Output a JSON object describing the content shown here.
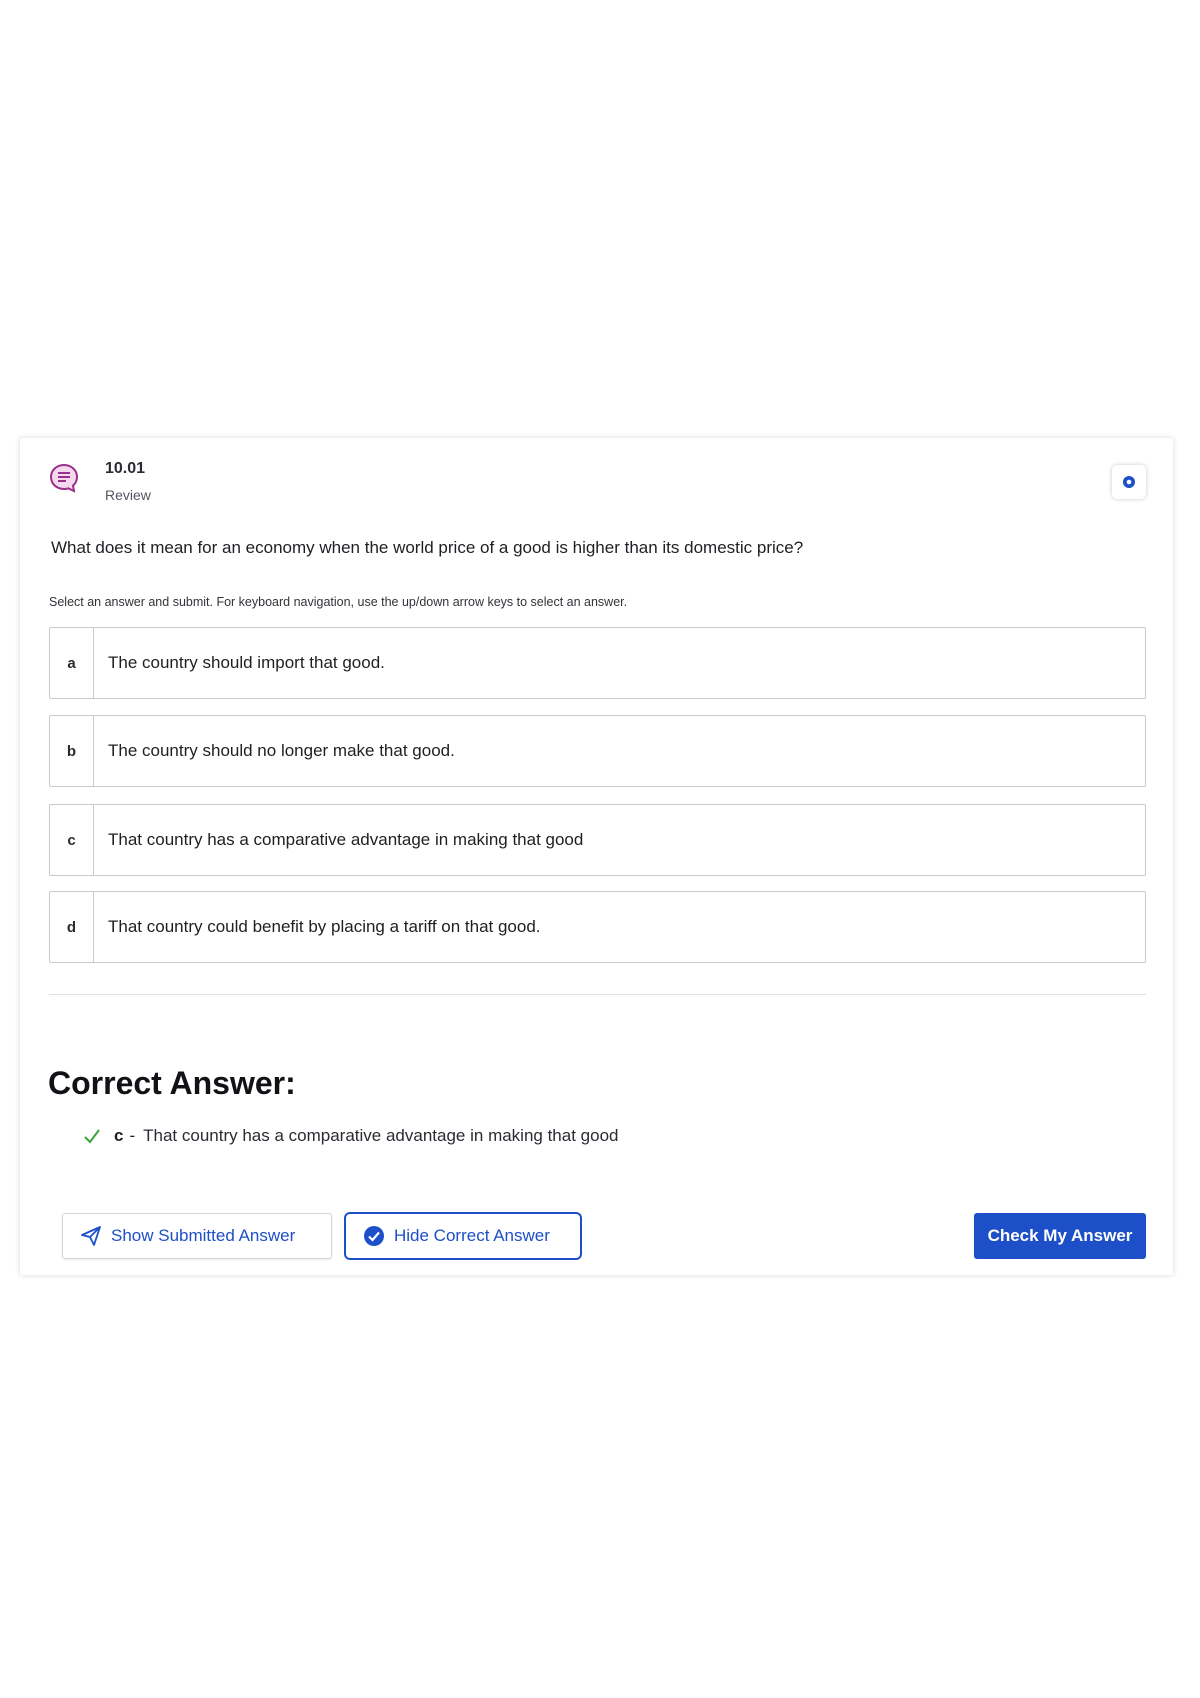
{
  "header": {
    "number": "10.01",
    "subtitle": "Review",
    "icon": "discussion-icon"
  },
  "settings": {
    "icon": "gear-icon"
  },
  "question": {
    "text": "What does it mean for an economy when the world price of a good is higher than its domestic price?",
    "instructions": "Select an answer and submit. For keyboard navigation, use the up/down arrow keys to select an answer."
  },
  "options": [
    {
      "letter": "a",
      "text": "The country should import that good."
    },
    {
      "letter": "b",
      "text": "The country should no longer make that good."
    },
    {
      "letter": "c",
      "text": "That country has a comparative advantage in making that good"
    },
    {
      "letter": "d",
      "text": "That country could benefit by placing a tariff on that good."
    }
  ],
  "correct_answer": {
    "heading": "Correct Answer:",
    "letter": "c",
    "separator": "-",
    "text": "That country has a comparative advantage in making that good"
  },
  "buttons": {
    "show_submitted": "Show Submitted Answer",
    "hide_correct": "Hide Correct Answer",
    "check": "Check My Answer"
  },
  "colors": {
    "accent": "#1d4fc8",
    "check_green": "#3aa33a",
    "discussion_icon": "#9b2f8a"
  }
}
